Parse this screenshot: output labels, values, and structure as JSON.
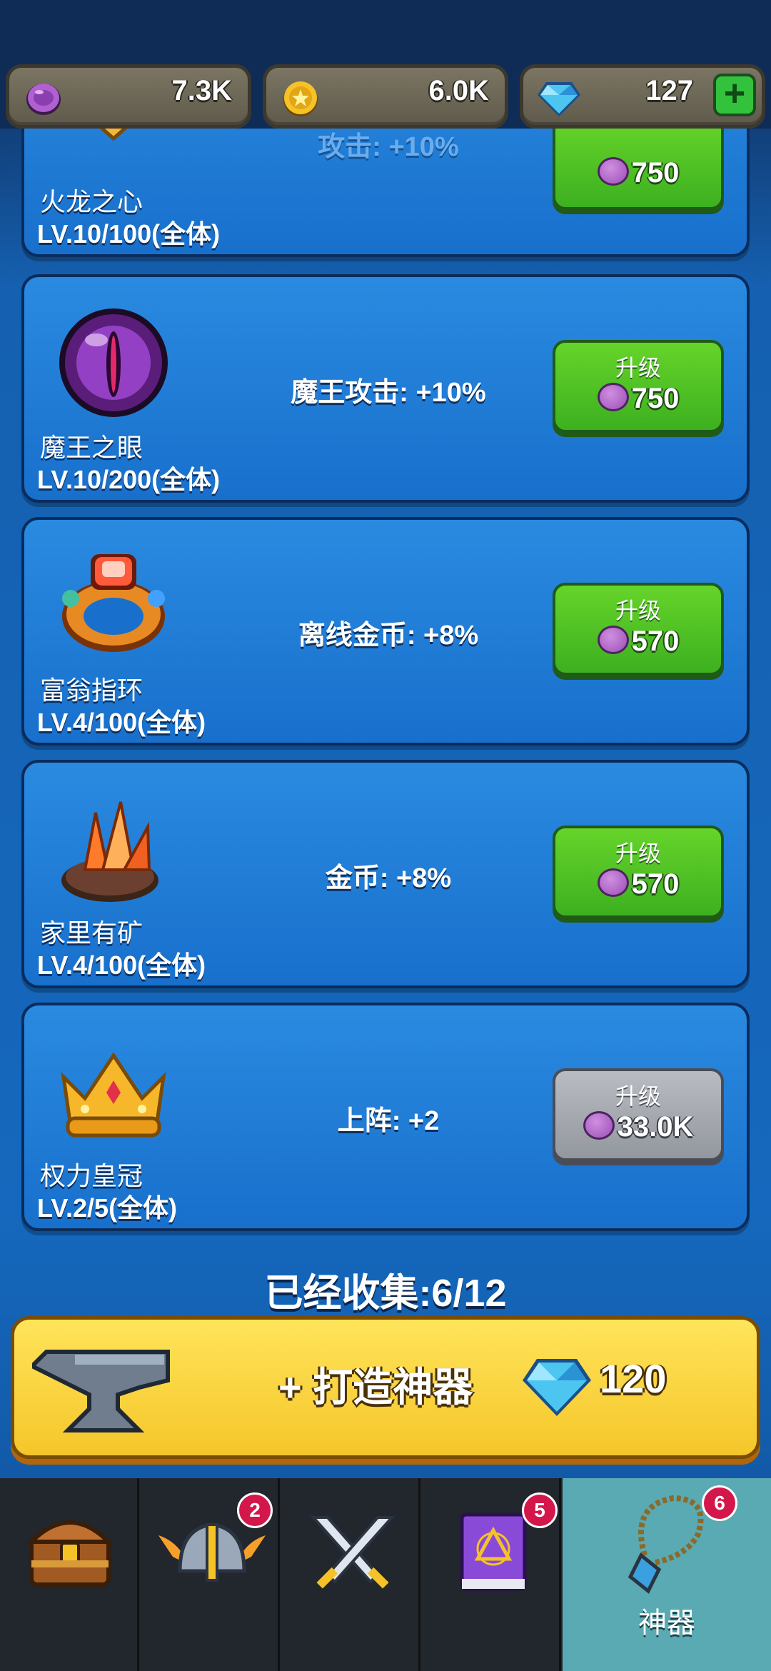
{
  "resources": {
    "gems_purple": "7.3K",
    "gold": "6.0K",
    "diamonds": "127"
  },
  "artifacts": [
    {
      "name": "火龙之心",
      "level": "LV.10/100(全体)",
      "effect": "攻击: +10%",
      "button_label": "",
      "cost": "750",
      "state": "available"
    },
    {
      "name": "魔王之眼",
      "level": "LV.10/200(全体)",
      "effect": "魔王攻击: +10%",
      "button_label": "升级",
      "cost": "750",
      "state": "available"
    },
    {
      "name": "富翁指环",
      "level": "LV.4/100(全体)",
      "effect": "离线金币: +8%",
      "button_label": "升级",
      "cost": "570",
      "state": "available"
    },
    {
      "name": "家里有矿",
      "level": "LV.4/100(全体)",
      "effect": "金币: +8%",
      "button_label": "升级",
      "cost": "570",
      "state": "available"
    },
    {
      "name": "权力皇冠",
      "level": "LV.2/5(全体)",
      "effect": "上阵: +2",
      "button_label": "升级",
      "cost": "33.0K",
      "state": "disabled"
    }
  ],
  "collected": "已经收集:6/12",
  "forge": {
    "label": "+ 打造神器",
    "cost": "120"
  },
  "nav": {
    "tabs": [
      {
        "icon": "treasure-chest-icon",
        "badge": ""
      },
      {
        "icon": "viking-helmet-icon",
        "badge": "2"
      },
      {
        "icon": "crossed-swords-icon",
        "badge": ""
      },
      {
        "icon": "spellbook-icon",
        "badge": "5"
      },
      {
        "icon": "amulet-icon",
        "badge": "6",
        "label": "神器",
        "active": true
      }
    ]
  }
}
